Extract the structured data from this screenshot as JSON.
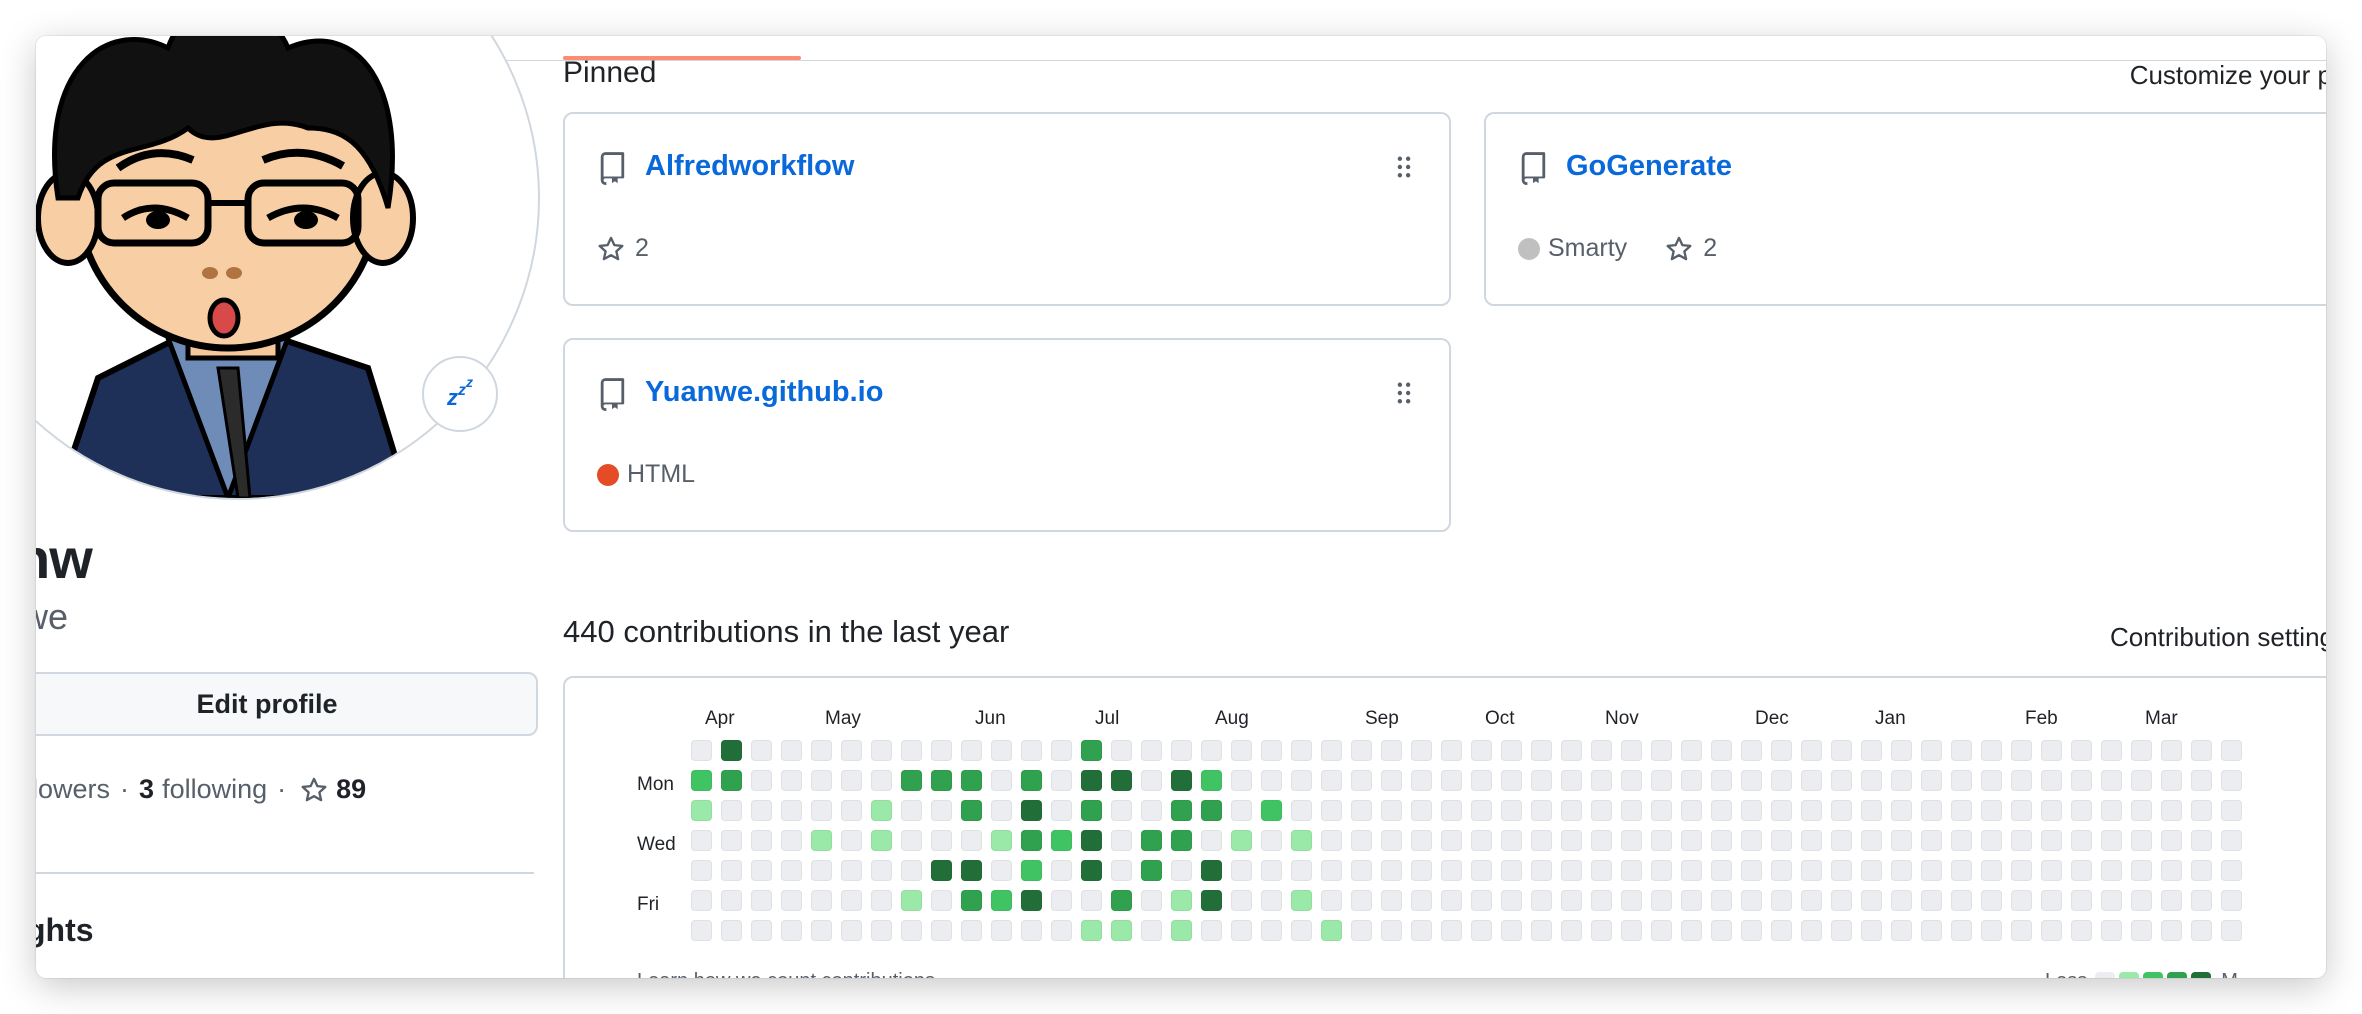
{
  "profile": {
    "name_fragment": "nw",
    "login_fragment": "we",
    "edit_label": "Edit profile",
    "followers_label": "llowers",
    "following_count": "3",
    "following_label": "following",
    "stars_count": "89",
    "highlights_fragment": "ghts",
    "status_icon": "zzz-icon"
  },
  "pinned": {
    "title": "Pinned",
    "customize_label": "Customize your p",
    "repos": [
      {
        "name": "Alfredworkflow",
        "language": "",
        "language_color": "",
        "stars": "2"
      },
      {
        "name": "GoGenerate",
        "language": "Smarty",
        "language_color": "#c0c0c0",
        "stars": "2"
      },
      {
        "name": "Yuanwe.github.io",
        "language": "HTML",
        "language_color": "#e34c26",
        "stars": ""
      }
    ]
  },
  "contributions": {
    "title": "440 contributions in the last year",
    "settings_label": "Contribution setting",
    "months": [
      "Apr",
      "May",
      "Jun",
      "Jul",
      "Aug",
      "Sep",
      "Oct",
      "Nov",
      "Dec",
      "Jan",
      "Feb",
      "Mar"
    ],
    "days": [
      "Mon",
      "Wed",
      "Fri"
    ],
    "footer_text": "Learn how we count contributions",
    "legend_less": "Less",
    "legend_more": "M",
    "colors": [
      "#ebedf0",
      "#9be9a8",
      "#40c463",
      "#30a14e",
      "#216e39"
    ],
    "grid": [
      "0400000000000300000000000000000000000000000000000000",
      "2300000333030440420000000000000000000000000000000000",
      "1000001003040300330200000000000000000000000000000000",
      "0000101000132403301010000000000000000000000000000000",
      "0000000044020403040000000000000000000000000000000000",
      "0000000103240030140010000000000000000000000000000000",
      "0000000000000110100001000000000000000000000000000000"
    ]
  }
}
